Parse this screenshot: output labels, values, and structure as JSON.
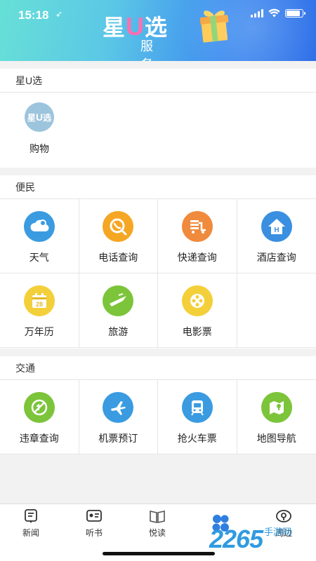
{
  "status_bar": {
    "time": "15:18",
    "location_glyph": "➶"
  },
  "banner": {
    "brand_text_1": "星",
    "brand_text_u": "U",
    "brand_text_2": "选",
    "brand_sub": "服务"
  },
  "sections": {
    "xingu": {
      "title": "星U选",
      "items": [
        {
          "label": "购物",
          "icon": "xingu-logo-icon",
          "logo_text_1": "星",
          "logo_text_u": "U",
          "logo_text_2": "选"
        }
      ]
    },
    "bianmin": {
      "title": "便民",
      "items": [
        {
          "label": "天气",
          "icon": "weather-icon",
          "color": "#3a9be0"
        },
        {
          "label": "电话查询",
          "icon": "phone-query-icon",
          "color": "#f5a623"
        },
        {
          "label": "快递查询",
          "icon": "express-icon",
          "color": "#f08a3c"
        },
        {
          "label": "酒店查询",
          "icon": "hotel-icon",
          "color": "#3a8fe0"
        },
        {
          "label": "万年历",
          "icon": "calendar-icon",
          "color": "#f3cf3a",
          "calendar_day": "28"
        },
        {
          "label": "旅游",
          "icon": "travel-icon",
          "color": "#7cc43a"
        },
        {
          "label": "电影票",
          "icon": "movie-icon",
          "color": "#f3cf3a"
        }
      ]
    },
    "jiaotong": {
      "title": "交通",
      "items": [
        {
          "label": "违章查询",
          "icon": "violation-icon",
          "color": "#7cc43a"
        },
        {
          "label": "机票预订",
          "icon": "airplane-icon",
          "color": "#3a9be0"
        },
        {
          "label": "抢火车票",
          "icon": "train-icon",
          "color": "#3a9be0"
        },
        {
          "label": "地图导航",
          "icon": "map-icon",
          "color": "#7cc43a"
        }
      ]
    }
  },
  "tabs": [
    {
      "label": "新闻",
      "icon": "news-icon"
    },
    {
      "label": "听书",
      "icon": "audiobook-icon"
    },
    {
      "label": "悦读",
      "icon": "book-icon"
    },
    {
      "label": "",
      "icon": "services-icon",
      "active": true
    },
    {
      "label": "周边",
      "icon": "nearby-icon"
    }
  ],
  "watermark": {
    "number": "2265",
    "site": "手游网"
  }
}
